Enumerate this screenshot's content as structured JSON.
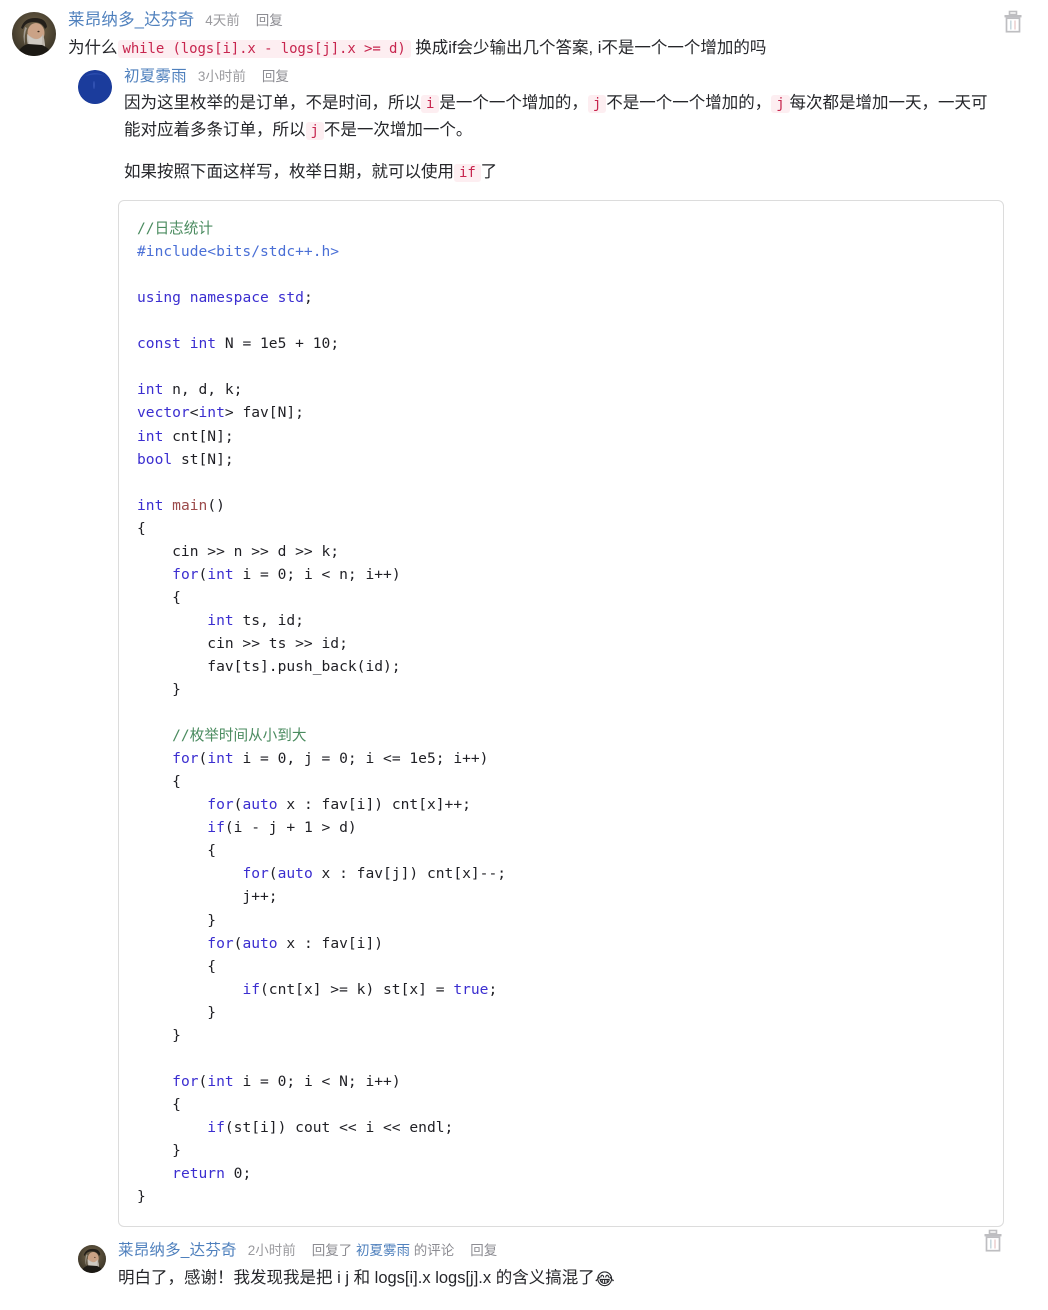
{
  "comments": [
    {
      "id": "c1",
      "author": "莱昂纳多_达芬奇",
      "time": "4天前",
      "reply_label": "回复",
      "avatar": "davinci-portrait",
      "text_before": "为什么",
      "inline_code": "while (logs[i].x - logs[j].x >= d)",
      "text_after": " 换成if会少输出几个答案, i不是一个一个增加的吗"
    },
    {
      "id": "c2",
      "author": "初夏雾雨",
      "time": "3小时前",
      "reply_label": "回复",
      "avatar": "blue-circle",
      "para1_a": "因为这里枚举的是订单，不是时间，所以",
      "code_i1": "i",
      "para1_b": "是一个一个增加的，",
      "code_j1": "j",
      "para1_c": "不是一个一个增加的，",
      "code_j2": "j",
      "para1_d": "每次都是增加一天，一天可能对应着多条订单，所以",
      "code_j3": "j",
      "para1_e": "不是一次增加一个。",
      "para2_a": "如果按照下面这样写，枚举日期，就可以使用",
      "code_if": "if",
      "para2_b": "了"
    },
    {
      "id": "c3",
      "author": "莱昂纳多_达芬奇",
      "time": "2小时前",
      "replied_prefix": "回复了",
      "replied_who": "初夏雾雨",
      "replied_suffix": "的评论",
      "reply_label": "回复",
      "avatar": "davinci-portrait",
      "text": "明白了，感谢！我发现我是把 i j 和 logs[i].x logs[j].x 的含义搞混了",
      "emoji": "😂"
    }
  ],
  "code_block": {
    "language": "cpp",
    "lines": [
      "//日志统计",
      "#include<bits/stdc++.h>",
      "",
      "using namespace std;",
      "",
      "const int N = 1e5 + 10;",
      "",
      "int n, d, k;",
      "vector<int> fav[N];",
      "int cnt[N];",
      "bool st[N];",
      "",
      "int main()",
      "{",
      "    cin >> n >> d >> k;",
      "    for(int i = 0; i < n; i++)",
      "    {",
      "        int ts, id;",
      "        cin >> ts >> id;",
      "        fav[ts].push_back(id);",
      "    }",
      "",
      "    //枚举时间从小到大",
      "    for(int i = 0, j = 0; i <= 1e5; i++)",
      "    {",
      "        for(auto x : fav[i]) cnt[x]++;",
      "        if(i - j + 1 > d)",
      "        {",
      "            for(auto x : fav[j]) cnt[x]--;",
      "            j++;",
      "        }",
      "        for(auto x : fav[i])",
      "        {",
      "            if(cnt[x] >= k) st[x] = true;",
      "        }",
      "    }",
      "",
      "    for(int i = 0; i < N; i++)",
      "    {",
      "        if(st[i]) cout << i << endl;",
      "    }",
      "    return 0;",
      "}"
    ]
  },
  "icons": {
    "trash_top": "trash-icon",
    "trash_bottom": "trash-icon"
  },
  "colors": {
    "author_link": "#4f80bd",
    "meta_gray": "#9a9a9e",
    "inline_code_bg": "#fdeef1",
    "inline_code_fg": "#c7254e",
    "code_keyword": "#3b2ed0",
    "code_comment": "#4a8b5f",
    "code_border": "#dcdcdc"
  }
}
